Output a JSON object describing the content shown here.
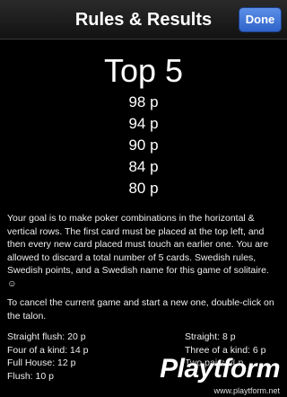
{
  "navbar": {
    "title": "Rules & Results",
    "done_label": "Done"
  },
  "top": {
    "title": "Top 5",
    "scores": [
      "98 p",
      "94 p",
      "90 p",
      "84 p",
      "80 p"
    ]
  },
  "rules": {
    "paragraph": "Your goal is to make poker combinations in the horizontal & vertical rows. The first card must be placed at the top left, and then every new card placed must touch an earlier one. You are allowed to discard a total number of 5 cards. Swedish rules, Swedish points, and a Swedish name for this game of solitaire. ☺",
    "cancel": "To cancel the current game and start a new one, double-click on the talon."
  },
  "points": {
    "left": [
      "Straight flush: 20 p",
      "Four of a kind: 14 p",
      "Full House: 12 p",
      "Flush: 10 p"
    ],
    "right": [
      "Straight: 8 p",
      "Three of a kind: 6 p",
      "Two pairs: 4 p"
    ]
  },
  "watermark": {
    "logo": "Playtform",
    "url": "www.playtform.net"
  }
}
